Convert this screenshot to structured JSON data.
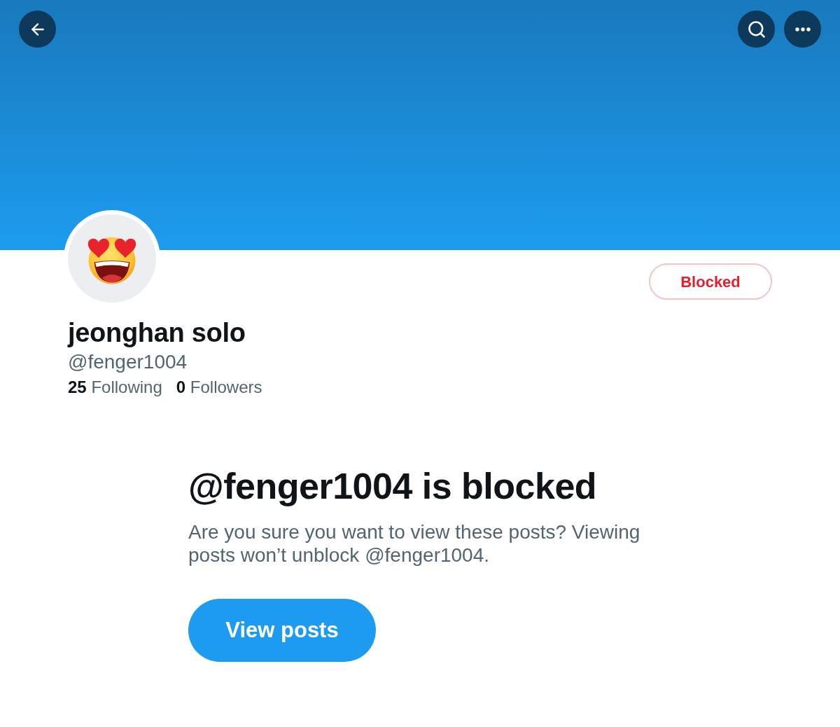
{
  "profile": {
    "name": "jeonghan solo",
    "handle": "@fenger1004",
    "stats": [
      {
        "count": "25",
        "label": "Following"
      },
      {
        "count": "0",
        "label": "Followers"
      }
    ],
    "status_button": "Blocked"
  },
  "blocked_notice": {
    "title": "@fenger1004 is blocked",
    "message": "Are you sure you want to view these posts? Viewing posts won’t unblock @fenger1004.",
    "button": "View posts"
  }
}
